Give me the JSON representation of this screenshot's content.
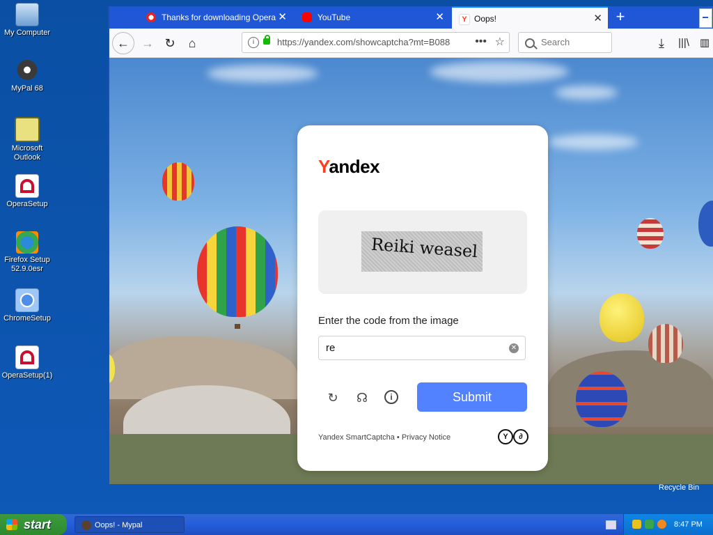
{
  "desktop": {
    "icons": [
      {
        "label": "My Computer"
      },
      {
        "label": "MyPal 68"
      },
      {
        "label": "Microsoft Outlook"
      },
      {
        "label": "OperaSetup"
      },
      {
        "label": "Firefox Setup 52.9.0esr"
      },
      {
        "label": "ChromeSetup"
      },
      {
        "label": "OperaSetup(1)"
      }
    ],
    "recycle_bin": "Recycle Bin"
  },
  "browser": {
    "tabs": [
      {
        "title": "Thanks for downloading Opera",
        "close": "✕"
      },
      {
        "title": "YouTube",
        "close": "✕"
      },
      {
        "title": "Oops!",
        "close": "✕"
      }
    ],
    "new_tab": "+",
    "url": "https://yandex.com/showcaptcha?mt=B088",
    "search_placeholder": "Search"
  },
  "captcha": {
    "logo_first": "Y",
    "logo_rest": "andex",
    "image_text": "Reiki weasel",
    "prompt": "Enter the code from the image",
    "input_value": "re",
    "submit_label": "Submit",
    "footer": "Yandex SmartCaptcha • Privacy Notice"
  },
  "taskbar": {
    "start_label": "start",
    "window_item": "Oops! - Mypal",
    "clock": "8:47 PM"
  },
  "colors": {
    "accent": "#5282ff",
    "yandex_red": "#fc3f1d",
    "tabbar": "#1f57d6"
  }
}
